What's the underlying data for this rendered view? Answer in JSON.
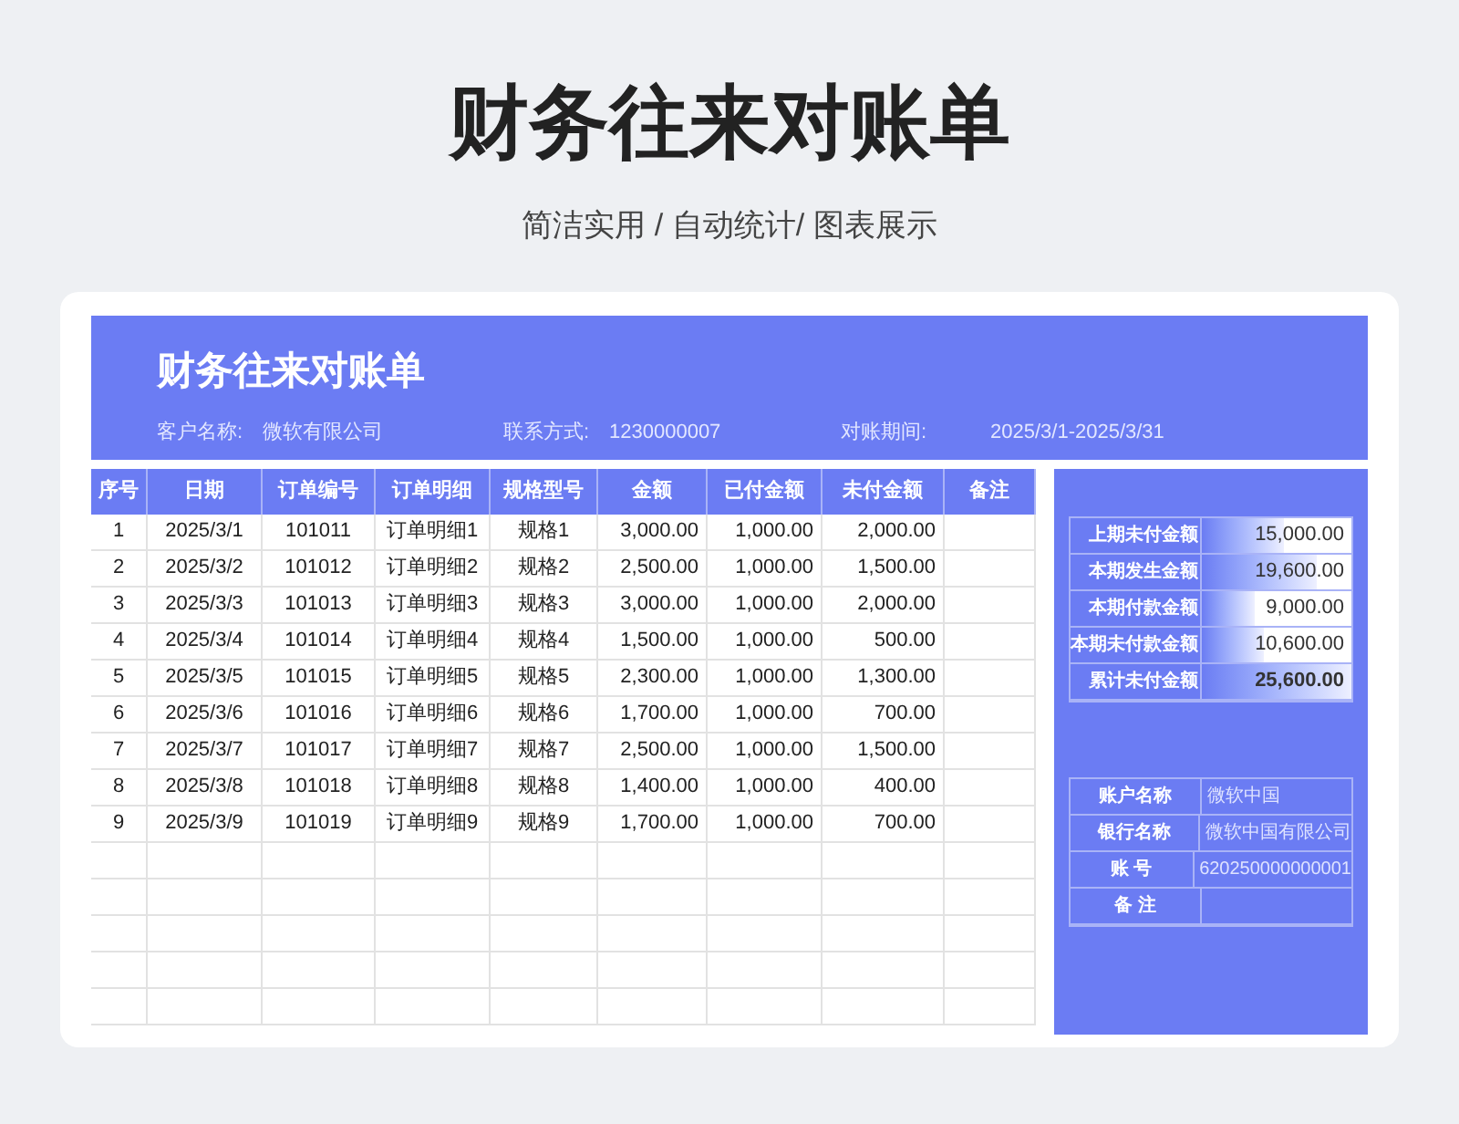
{
  "title": "财务往来对账单",
  "subtitle": "简洁实用 / 自动统计/ 图表展示",
  "sheet": {
    "title": "财务往来对账单",
    "info": [
      {
        "label": "客户名称:",
        "value": "微软有限公司"
      },
      {
        "label": "联系方式:",
        "value": "1230000007"
      },
      {
        "label": "对账期间:",
        "value": "2025/3/1-2025/3/31"
      }
    ],
    "table": {
      "columns": [
        "序号",
        "日期",
        "订单编号",
        "订单明细",
        "规格型号",
        "金额",
        "已付金额",
        "未付金额",
        "备注"
      ],
      "rows": [
        [
          "1",
          "2025/3/1",
          "101011",
          "订单明细1",
          "规格1",
          "3,000.00",
          "1,000.00",
          "2,000.00"
        ],
        [
          "2",
          "2025/3/2",
          "101012",
          "订单明细2",
          "规格2",
          "2,500.00",
          "1,000.00",
          "1,500.00"
        ],
        [
          "3",
          "2025/3/3",
          "101013",
          "订单明细3",
          "规格3",
          "3,000.00",
          "1,000.00",
          "2,000.00"
        ],
        [
          "4",
          "2025/3/4",
          "101014",
          "订单明细4",
          "规格4",
          "1,500.00",
          "1,000.00",
          "500.00"
        ],
        [
          "5",
          "2025/3/5",
          "101015",
          "订单明细5",
          "规格5",
          "2,300.00",
          "1,000.00",
          "1,300.00"
        ],
        [
          "6",
          "2025/3/6",
          "101016",
          "订单明细6",
          "规格6",
          "1,700.00",
          "1,000.00",
          "700.00"
        ],
        [
          "7",
          "2025/3/7",
          "101017",
          "订单明细7",
          "规格7",
          "2,500.00",
          "1,000.00",
          "1,500.00"
        ],
        [
          "8",
          "2025/3/8",
          "101018",
          "订单明细8",
          "规格8",
          "1,400.00",
          "1,000.00",
          "400.00"
        ],
        [
          "9",
          "2025/3/9",
          "101019",
          "订单明细9",
          "规格9",
          "1,700.00",
          "1,000.00",
          "700.00"
        ]
      ]
    },
    "summary": [
      {
        "label": "上期未付金额",
        "value": "15,000.00",
        "level": 0.55,
        "emphasized": false
      },
      {
        "label": "本期发生金额",
        "value": "19,600.00",
        "level": 0.77,
        "emphasized": false
      },
      {
        "label": "本期付款金额",
        "value": "9,000.00",
        "level": 0.35,
        "emphasized": false
      },
      {
        "label": "本期未付款金额",
        "value": "10,600.00",
        "level": 0.41,
        "emphasized": false
      },
      {
        "label": "累计未付金额",
        "value": "25,600.00",
        "level": 1,
        "emphasized": true
      }
    ],
    "account": [
      {
        "label": "账户名称",
        "value": "微软中国"
      },
      {
        "label": "银行名称",
        "value": "微软中国有限公司"
      },
      {
        "label": "账 号",
        "value": "620250000000001"
      },
      {
        "label": "备 注"
      }
    ]
  }
}
